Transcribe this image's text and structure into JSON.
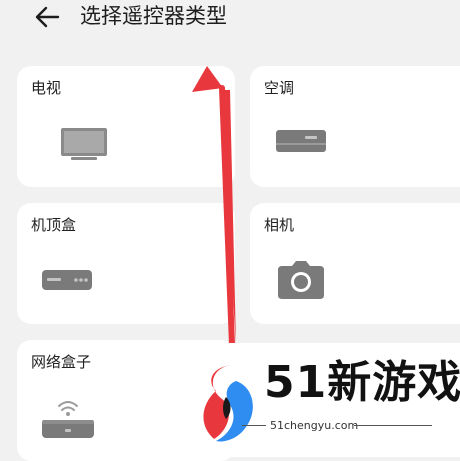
{
  "header": {
    "back_icon": "arrow-left-icon",
    "title": "选择遥控器类型"
  },
  "cards": [
    {
      "label": "电视",
      "icon": "tv-icon"
    },
    {
      "label": "空调",
      "icon": "air-conditioner-icon"
    },
    {
      "label": "机顶盒",
      "icon": "set-top-box-icon"
    },
    {
      "label": "相机",
      "icon": "camera-icon"
    },
    {
      "label": "网络盒子",
      "icon": "network-box-icon"
    }
  ],
  "watermark": {
    "name": "51新游戏",
    "url": "51chengyu.com",
    "logo": "s-logo-icon"
  },
  "annotation": {
    "arrow_icon": "red-arrow-icon",
    "color": "#e8383d"
  },
  "colors": {
    "background": "#f1f1f1",
    "card": "#ffffff",
    "icon_gray": "#7a7a7a",
    "logo_red": "#e8383d",
    "logo_blue": "#2f8cf0"
  }
}
